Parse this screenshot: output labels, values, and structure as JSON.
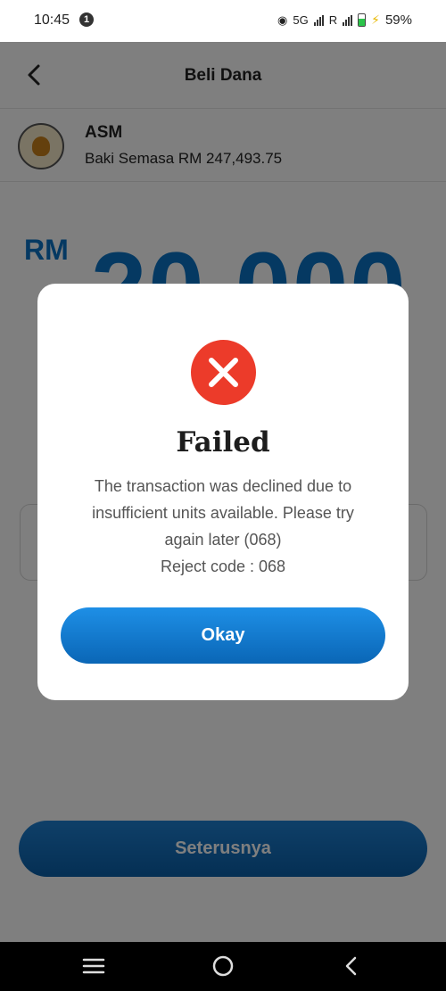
{
  "status_bar": {
    "time": "10:45",
    "notification_count": "1",
    "network": "5G",
    "roaming": "R",
    "battery_percent": "59%",
    "battery_level": 0.59
  },
  "header": {
    "title": "Beli Dana",
    "back_icon": "chevron-left-icon"
  },
  "fund": {
    "logo_icon": "amanah-saham-malaysia-logo",
    "name": "ASM",
    "balance": "Baki Semasa RM 247,493.75"
  },
  "amount": {
    "currency": "RM",
    "value": "20,000"
  },
  "footer": {
    "next_label": "Seterusnya"
  },
  "modal": {
    "icon": "error-x-icon",
    "title": "Failed",
    "message": "The transaction was declined due to insufficient units available. Please try again later (068)",
    "reject_code": "Reject code : 068",
    "okay_label": "Okay"
  },
  "nav_bar": {
    "recents_icon": "recents-lines-icon",
    "home_icon": "home-circle-icon",
    "back_icon": "back-chevron-icon"
  },
  "colors": {
    "accent": "#0a73c4",
    "error": "#ec3b2a",
    "button_gradient_top": "#1e8fe6",
    "button_gradient_bottom": "#0a66b6"
  }
}
